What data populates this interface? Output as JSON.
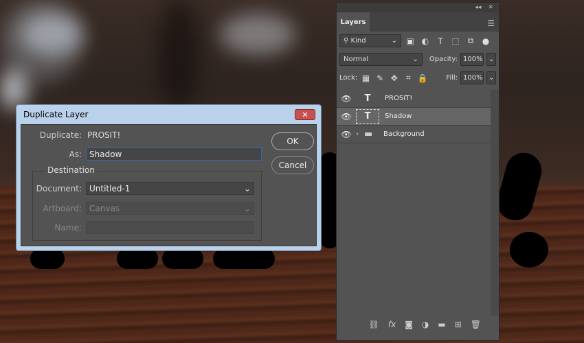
{
  "layers_panel": {
    "tab_label": "Layers",
    "filter_kind": "Kind",
    "blend_mode": "Normal",
    "opacity_label": "Opacity:",
    "opacity_value": "100%",
    "lock_label": "Lock:",
    "fill_label": "Fill:",
    "fill_value": "100%",
    "layers": [
      {
        "name": "PROSIT!",
        "type": "text",
        "thumb": "T",
        "active": false
      },
      {
        "name": "Shadow",
        "type": "text",
        "thumb": "T",
        "active": true
      },
      {
        "name": "Background",
        "type": "group",
        "thumb": "folder",
        "active": false
      }
    ]
  },
  "dialog": {
    "title": "Duplicate Layer",
    "close_label": "✕",
    "duplicate_label": "Duplicate:",
    "duplicate_value": "PROSIT!",
    "as_label": "As:",
    "as_value": "Shadow",
    "destination_label": "Destination",
    "document_label": "Document:",
    "document_value": "Untitled-1",
    "artboard_label": "Artboard:",
    "artboard_value": "Canvas",
    "name_label": "Name:",
    "name_value": "",
    "ok_label": "OK",
    "cancel_label": "Cancel"
  }
}
